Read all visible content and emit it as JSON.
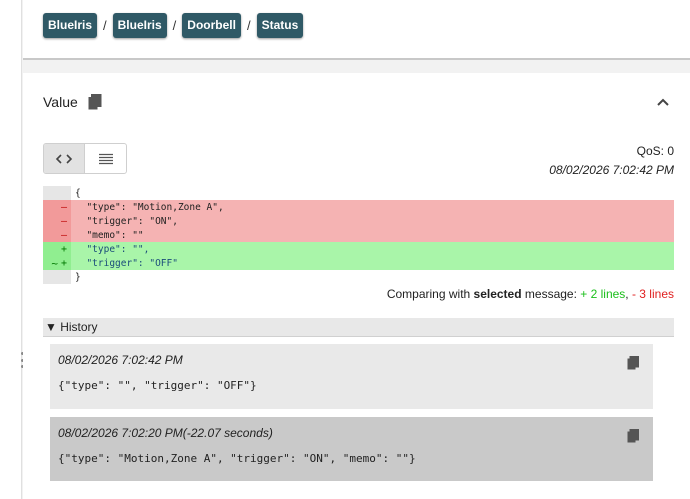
{
  "breadcrumb": [
    "BlueIris",
    "BlueIris",
    "Doorbell",
    "Status"
  ],
  "breadcrumb_separator": "/",
  "value_panel": {
    "title": "Value",
    "qos": "QoS: 0",
    "timestamp": "08/02/2026 7:02:42 PM"
  },
  "diff": {
    "lines": [
      {
        "type": "context",
        "gutter": "",
        "code": "{"
      },
      {
        "type": "removed",
        "gutter": "–",
        "code": "  \"type\": \"Motion,Zone A\","
      },
      {
        "type": "removed",
        "gutter": "–",
        "code": "  \"trigger\": \"ON\","
      },
      {
        "type": "removed",
        "gutter": "–",
        "code": "  \"memo\": \"\""
      },
      {
        "type": "added",
        "gutter": "+",
        "code": "  \"type\": \"\","
      },
      {
        "type": "added",
        "gutter": "+",
        "marker": "~",
        "code": "  \"trigger\": \"OFF\""
      },
      {
        "type": "context",
        "gutter": "",
        "code": "}"
      }
    ]
  },
  "compare": {
    "prefix": "Comparing with ",
    "bold": "selected",
    "mid": " message: ",
    "added": "+ 2 lines",
    "comma": ", ",
    "removed": "- 3 lines"
  },
  "history": {
    "title": "▼ History",
    "items": [
      {
        "timestamp": "08/02/2026 7:02:42 PM",
        "message": "{\"type\": \"\", \"trigger\": \"OFF\"}"
      },
      {
        "timestamp": "08/02/2026 7:02:20 PM(-22.07 seconds)",
        "message": "{\"type\": \"Motion,Zone A\", \"trigger\": \"ON\", \"memo\": \"\"}"
      }
    ]
  },
  "colors": {
    "crumb_bg": "#2f5966",
    "removed_bg": "#f5b3b3",
    "added_bg": "#a9f5a9",
    "added_text": "#1bbf1b",
    "removed_text": "#e02020"
  }
}
